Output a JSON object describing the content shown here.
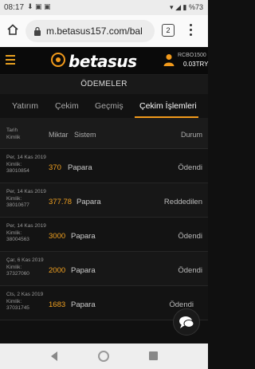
{
  "status_bar": {
    "time": "08:17",
    "battery": "%73"
  },
  "browser": {
    "url": "m.betasus157.com/bal",
    "tab_count": "2"
  },
  "header": {
    "logo": "betasus",
    "username": "RCBO1500",
    "balance": "0.03TRY",
    "accent_color": "#f29a1b"
  },
  "page": {
    "title": "ÖDEMELER"
  },
  "tabs": [
    {
      "label": "Yatırım"
    },
    {
      "label": "Çekim"
    },
    {
      "label": "Geçmiş"
    },
    {
      "label": "Çekim İşlemleri",
      "active": true
    }
  ],
  "table": {
    "headers": {
      "tarih": "Tarih",
      "kimlik": "Kimlik",
      "miktar": "Miktar",
      "sistem": "Sistem",
      "durum": "Durum"
    },
    "rows": [
      {
        "date": "Per, 14 Kas 2019",
        "id_label": "Kimlik:",
        "id": "38010854",
        "amount": "370",
        "system": "Papara",
        "status": "Ödendi"
      },
      {
        "date": "Per, 14 Kas 2019",
        "id_label": "Kimlik:",
        "id": "38010677",
        "amount": "377.78",
        "system": "Papara",
        "status": "Reddedilen"
      },
      {
        "date": "Per, 14 Kas 2019",
        "id_label": "Kimlik:",
        "id": "38004563",
        "amount": "3000",
        "system": "Papara",
        "status": "Ödendi"
      },
      {
        "date": "Çar, 6 Kas 2019",
        "id_label": "Kimlik:",
        "id": "37327060",
        "amount": "2000",
        "system": "Papara",
        "status": "Ödendi"
      },
      {
        "date": "Cts, 2 Kas 2019",
        "id_label": "Kimlik:",
        "id": "37031745",
        "amount": "1683",
        "system": "Papara",
        "status": "Ödendi"
      }
    ]
  }
}
